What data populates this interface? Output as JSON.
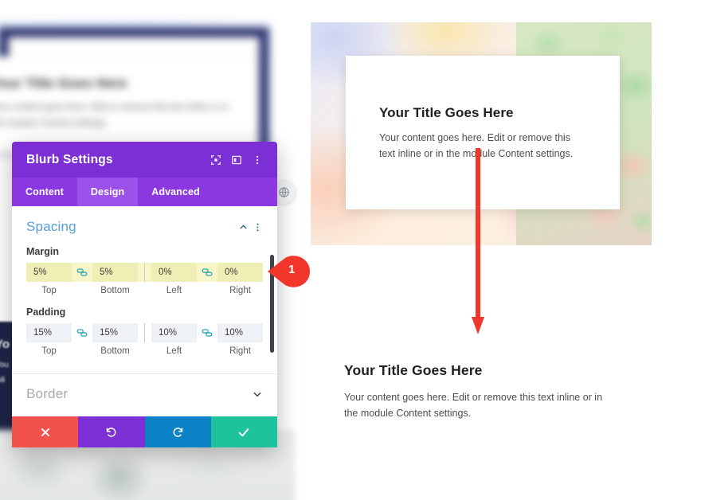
{
  "modal": {
    "title": "Blurb Settings",
    "header_icons": [
      {
        "name": "expand-fullscreen-icon"
      },
      {
        "name": "panel-layout-icon"
      },
      {
        "name": "kebab-menu-icon"
      }
    ],
    "tabs": [
      {
        "label": "Content",
        "active": false
      },
      {
        "label": "Design",
        "active": true
      },
      {
        "label": "Advanced",
        "active": false
      }
    ],
    "spacing_section": {
      "title": "Spacing",
      "collapse_icon": "chevron-up-icon",
      "menu_icon": "kebab-menu-icon",
      "margin": {
        "label": "Margin",
        "highlighted": true,
        "fields": [
          {
            "value": "5%",
            "label": "Top"
          },
          {
            "value": "5%",
            "label": "Bottom"
          },
          {
            "value": "0%",
            "label": "Left"
          },
          {
            "value": "0%",
            "label": "Right"
          }
        ]
      },
      "padding": {
        "label": "Padding",
        "highlighted": false,
        "fields": [
          {
            "value": "15%",
            "label": "Top"
          },
          {
            "value": "15%",
            "label": "Bottom"
          },
          {
            "value": "10%",
            "label": "Left"
          },
          {
            "value": "10%",
            "label": "Right"
          }
        ]
      }
    },
    "border_section": {
      "title": "Border",
      "expand_icon": "chevron-down-icon"
    },
    "footer": {
      "cancel": {
        "icon": "close-x-icon",
        "color": "#f2524c"
      },
      "undo": {
        "icon": "undo-arrow-icon",
        "color": "#7b2fd4"
      },
      "redo": {
        "icon": "redo-arrow-icon",
        "color": "#0b81c6"
      },
      "save": {
        "icon": "checkmark-icon",
        "color": "#1fc39b"
      }
    },
    "colors": {
      "header": "#7b2fd4",
      "tabbar": "#8b38e0",
      "tab_active": "#9c52ea",
      "section_title": "#52a0d8",
      "highlight": "#f7f6c9"
    }
  },
  "callout": {
    "number": "1",
    "color": "#f2362b"
  },
  "preview": {
    "hero_card": {
      "title": "Your Title Goes Here",
      "body": "Your content goes here. Edit or remove this text inline or in the module Content settings."
    },
    "bottom_block": {
      "title": "Your Title Goes Here",
      "body": "Your content goes here. Edit or remove this text inline or in the module Content settings."
    },
    "arrow": {
      "name": "red-down-arrow",
      "color": "#f2362b"
    }
  },
  "background": {
    "blurred_card": {
      "title": "Your Title Goes Here",
      "body": "Your content goes here. Edit or remove this text inline or in the module Content settings."
    },
    "navy_text": "Yo",
    "navy_sub": "You\ninli"
  }
}
